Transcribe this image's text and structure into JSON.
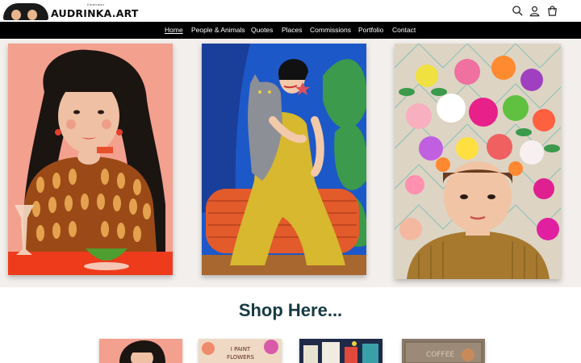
{
  "brand": {
    "name": "AUDRINKA.ART",
    "tagline": "illustrator"
  },
  "header_icons": [
    "search-icon",
    "user-icon",
    "cart-icon"
  ],
  "nav": {
    "items": [
      {
        "label": "Home",
        "active": true
      },
      {
        "label": "People & Animals",
        "active": false
      },
      {
        "label": "Quotes",
        "active": false
      },
      {
        "label": "Places",
        "active": false
      },
      {
        "label": "Commissions",
        "active": false
      },
      {
        "label": "Portfolio",
        "active": false
      },
      {
        "label": "Contact",
        "active": false
      }
    ]
  },
  "hero": {
    "artworks": [
      "woman-with-cocktail-painting",
      "woman-with-cat-painting",
      "woman-with-flower-crown-painting"
    ]
  },
  "shop": {
    "title": "Shop Here..."
  },
  "colors": {
    "nav_bg": "#000000",
    "hero_bg": "#f2efec",
    "title": "#163a43"
  }
}
